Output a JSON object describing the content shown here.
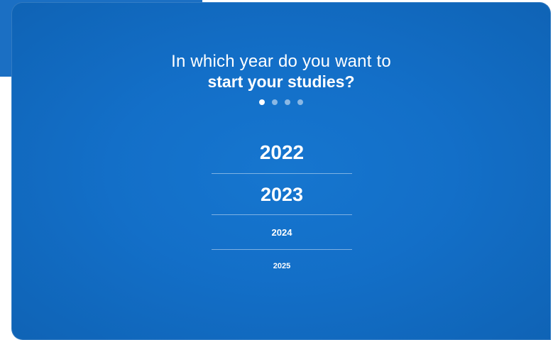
{
  "question": {
    "line1": "In which year do you want to",
    "line2": "start your studies?"
  },
  "progress": {
    "total_steps": 4,
    "current_step": 1
  },
  "years": [
    {
      "label": "2022"
    },
    {
      "label": "2023"
    },
    {
      "label": "2024"
    },
    {
      "label": "2025"
    }
  ],
  "colors": {
    "card_background": "#136fc8",
    "accent_strip": "#1b6fc3",
    "text": "#ffffff"
  }
}
